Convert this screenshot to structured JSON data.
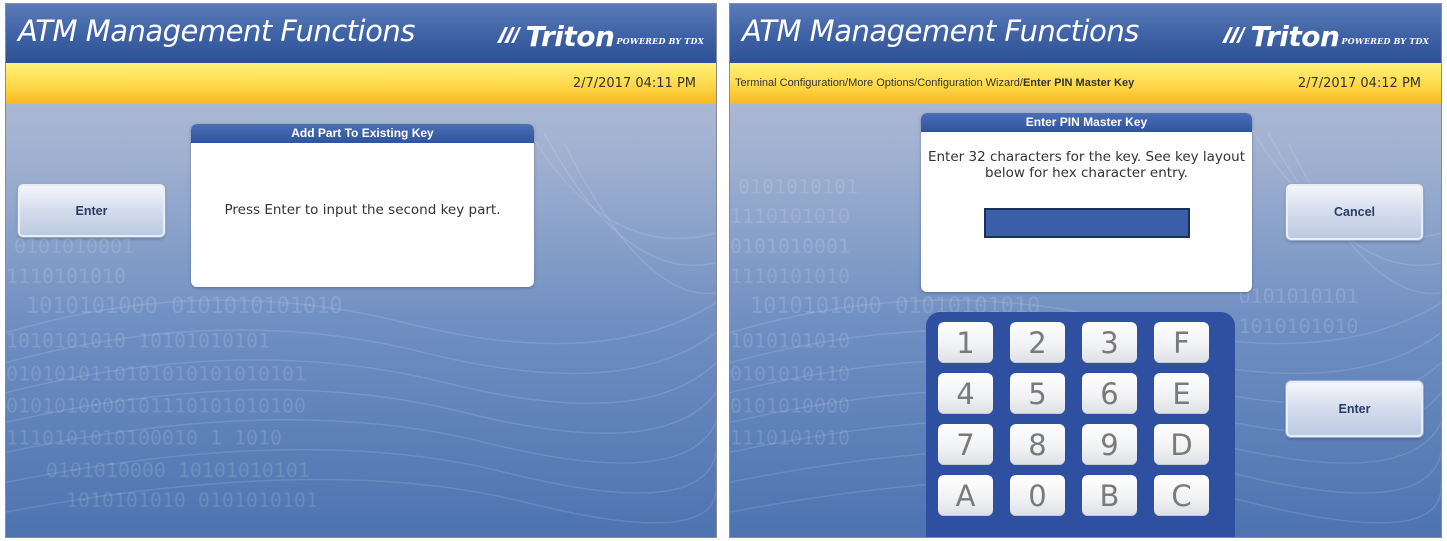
{
  "colors": {
    "header_blue": "#3d61a4",
    "bar_yellow": "#ffd84a",
    "dialog_head_blue": "#2e54a0",
    "keypad_blue": "#2f4fa0",
    "input_blue": "#3a5fa8"
  },
  "left_screen": {
    "header_title": "ATM Management Functions",
    "logo": {
      "word": "Triton",
      "sub": "POWERED BY TDX",
      "icon": "triton-logo-icon"
    },
    "datetime": "2/7/2017  04:11 PM",
    "dialog": {
      "title": "Add Part To Existing Key",
      "message": "Press Enter to input the second key part."
    },
    "enter_button": "Enter"
  },
  "right_screen": {
    "header_title": "ATM Management Functions",
    "logo": {
      "word": "Triton",
      "sub": "POWERED BY TDX",
      "icon": "triton-logo-icon"
    },
    "breadcrumb_path": "Terminal Configuration/More Options/Configuration Wizard/",
    "breadcrumb_current": "Enter PIN Master Key",
    "datetime": "2/7/2017  04:12 PM",
    "dialog": {
      "title": "Enter PIN Master Key",
      "message_line1": "Enter 32 characters for the key.  See key layout",
      "message_line2": "below for hex character entry.",
      "input_value": ""
    },
    "cancel_button": "Cancel",
    "enter_button": "Enter",
    "keypad": [
      [
        "1",
        "2",
        "3",
        "F"
      ],
      [
        "4",
        "5",
        "6",
        "E"
      ],
      [
        "7",
        "8",
        "9",
        "D"
      ],
      [
        "A",
        "0",
        "B",
        "C"
      ]
    ]
  }
}
